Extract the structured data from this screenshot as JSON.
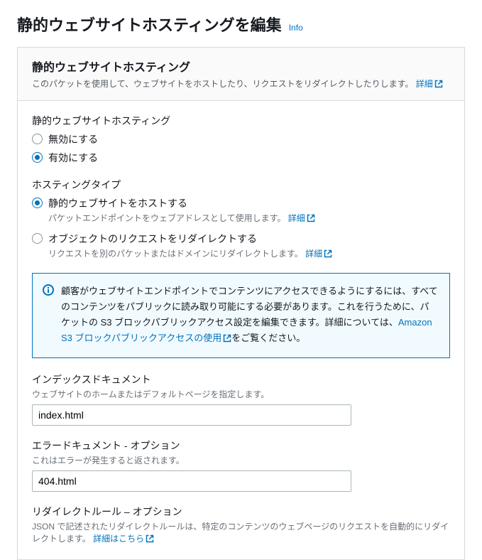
{
  "header": {
    "title": "静的ウェブサイトホスティングを編集",
    "info": "Info"
  },
  "panel": {
    "title": "静的ウェブサイトホスティング",
    "desc": "このパケットを使用して、ウェブサイトをホストしたり、リクエストをリダイレクトしたりします。",
    "detail_link": "詳細"
  },
  "hosting": {
    "label": "静的ウェブサイトホスティング",
    "disable": "無効にする",
    "enable": "有効にする"
  },
  "hosting_type": {
    "label": "ホスティングタイプ",
    "host": {
      "label": "静的ウェブサイトをホストする",
      "hint": "パケットエンドポイントをウェブアドレスとして使用します。",
      "link": "詳細"
    },
    "redirect": {
      "label": "オブジェクトのリクエストをリダイレクトする",
      "hint": "リクエストを別のパケットまたはドメインにリダイレクトします。",
      "link": "詳細"
    }
  },
  "infobox": {
    "text_a": "顧客がウェブサイトエンドポイントでコンテンツにアクセスできるようにするには、すべてのコンテンツをパブリックに読み取り可能にする必要があります。これを行うために、パケットの S3 ブロックパブリックアクセス設定を編集できます。詳細については、",
    "link": "Amazon S3 ブロックパブリックアクセスの使用",
    "text_b": "をご覧ください。"
  },
  "index_doc": {
    "label": "インデックスドキュメント",
    "hint": "ウェブサイトのホームまたはデフォルトページを指定します。",
    "value": "index.html"
  },
  "error_doc": {
    "label": "エラードキュメント - オプション",
    "hint": "これはエラーが発生すると返されます。",
    "value": "404.html"
  },
  "redirect_rules": {
    "label": "リダイレクトルール – オプション",
    "hint": "JSON で記述されたリダイレクトルールは、特定のコンテンツのウェブページのリクエストを自動的にリダイレクトします。",
    "link": "詳細はこちら"
  }
}
